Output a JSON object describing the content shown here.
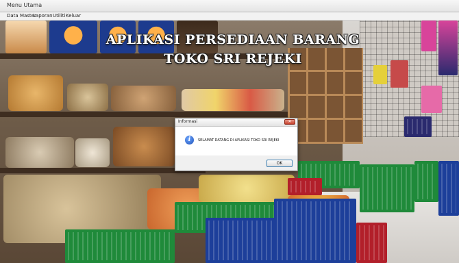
{
  "window": {
    "title": "Menu Utama"
  },
  "menu": [
    {
      "label": "Data Master"
    },
    {
      "label": "Laporan"
    },
    {
      "label": "Utiliti"
    },
    {
      "label": "Keluar"
    }
  ],
  "banner": {
    "line1": "APLIKASI PERSEDIAAN BARANG",
    "line2": "TOKO SRI REJEKI"
  },
  "dialog": {
    "title": "Informasi",
    "message": "SELAMAT DATANG DI APLIKASI TOKO SRI REJEKI",
    "ok_label": "OK",
    "icon": "info-icon"
  },
  "colors": {
    "dialog_close": "#c7402c",
    "ok_border": "#3c7fb1",
    "crate_green": "#1f8a3a",
    "crate_blue": "#1d3f9a",
    "crate_red": "#b21f2a"
  }
}
